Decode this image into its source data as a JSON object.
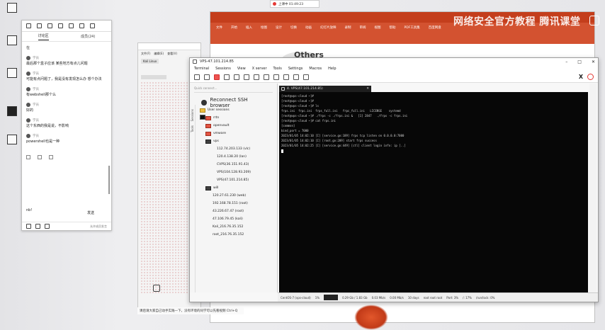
{
  "desktop": {
    "icons": [
      {
        "name": "doc-icon",
        "label": ""
      },
      {
        "name": "app-icon",
        "label": ""
      },
      {
        "name": "mobaxterm-icon",
        "label": ""
      },
      {
        "name": "folder-icon",
        "label": ""
      },
      {
        "name": "terminal-icon",
        "label": ""
      }
    ]
  },
  "chat": {
    "tabs": [
      "讨论区",
      "成员(24)"
    ],
    "messages": [
      {
        "text": "在"
      },
      {
        "name": "学员",
        "text": "最后那个盒子应该 某些地方有点儿问题"
      },
      {
        "name": "学员",
        "text": "可能有点问题了，我是没有发现怎么办 想个办法"
      },
      {
        "name": "学员",
        "text": "有webshell那个么"
      },
      {
        "name": "学员",
        "text": "好的"
      },
      {
        "name": "学员",
        "text": "这个东西的我是说，不影响"
      },
      {
        "name": "学员",
        "text": "powershell也是一种"
      }
    ],
    "input_text": "nb!",
    "send_label": "发送",
    "bottom_text": "允许成员发言"
  },
  "record_bar": {
    "text": "上课中 01:49:23"
  },
  "ppt": {
    "menu": [
      "文件",
      "开始",
      "插入",
      "绘图",
      "设计",
      "切换",
      "动画",
      "幻灯片放映",
      "录制",
      "审阅",
      "视图",
      "帮助",
      "PDF工具集",
      "百度网盘"
    ],
    "slide_heading": "Others"
  },
  "watermark": "网络安全官方教程 腾讯课堂",
  "bgwin": {
    "menu": [
      "文件(F)",
      "编辑(E)",
      "查看(V)"
    ],
    "tab": "Kali Linux",
    "path_tab": "File (1)"
  },
  "moba": {
    "title": "VPS-47.101.214.85",
    "menu": [
      "Terminal",
      "Sessions",
      "View",
      "X server",
      "Tools",
      "Settings",
      "Macros",
      "Help"
    ],
    "quick_connect_placeholder": "Quick connect...",
    "reconnect_label": "Reconnect SSH browser",
    "vtabs": [
      "Sessions",
      "Tools"
    ],
    "tree": [
      {
        "kind": "folder",
        "color": "yellow",
        "label": "User sessions",
        "level": 0
      },
      {
        "kind": "folder",
        "color": "red",
        "label": "rrtn",
        "level": 1
      },
      {
        "kind": "folder",
        "color": "red",
        "label": "openvault",
        "level": 1
      },
      {
        "kind": "folder",
        "color": "red",
        "label": "vmware",
        "level": 1
      },
      {
        "kind": "folder",
        "color": "dark",
        "label": "vps",
        "level": 1
      },
      {
        "kind": "term",
        "label": "112.74.203.133 (vlc)",
        "level": 2
      },
      {
        "kind": "term",
        "label": "120.4.138.20 (lan)",
        "level": 2
      },
      {
        "kind": "term",
        "label": "CVPS(36.151.91.43)",
        "level": 2
      },
      {
        "kind": "term",
        "label": "VPS(104.128.93.209)",
        "level": 2
      },
      {
        "kind": "term",
        "label": "VPS(47.101.214.85)",
        "level": 2
      },
      {
        "kind": "folder",
        "color": "dark",
        "label": "will",
        "level": 1
      },
      {
        "kind": "term",
        "label": "120.27.61.230 (web)",
        "level": 2
      },
      {
        "kind": "term",
        "label": "192.168.78.151 (root)",
        "level": 2
      },
      {
        "kind": "term",
        "label": "43.226.67.47 (root)",
        "level": 2
      },
      {
        "kind": "term",
        "label": "47.106.79.45 (kali)",
        "level": 2
      },
      {
        "kind": "term",
        "label": "Kali_216.76.35.152",
        "level": 2
      },
      {
        "kind": "term",
        "label": "root_216.76.35.152",
        "level": 2
      }
    ],
    "terminal_tab": "4. VPS(47.101.214.85)",
    "terminal_lines": [
      "[root@vps-cloud ~]#",
      "[root@vps-cloud ~]#",
      "[root@vps-cloud ~]# ls",
      "frps.ini  frpc.ini  frps_full.ini   frpc_full.ini   LICENSE    systemd",
      "[root@vps-cloud ~]# ./frps -c ./frps.ini &   [1] 2847   ./frps -c frps.ini",
      "[root@vps-cloud ~]# cat frps.ini",
      "[common]",
      "bind_port = 7000",
      "2023/01/05 14:02:10 [I] [service.go:189] frps tcp listen on 0.0.0.0:7000",
      "2023/01/05 14:02:10 [I] [root.go:209] start frps success",
      "2023/01/05 14:02:25 [I] [service.go:449] [ctl] client login info: ip [..]"
    ],
    "status": [
      "CentOS-7 (vps-cloud)",
      "1%",
      "0.29 Gb / 1.83 Gb",
      "0.03 Mb/s",
      "0.00 Mb/s",
      "10 days",
      "root  root  root",
      "Part: 3%",
      "/: 17%",
      "/run/lock: 0%"
    ]
  },
  "subtitle_bar": "课后请大家自己动手实践一下，没有环境的同学可以先看视频 Ctrl+Q"
}
